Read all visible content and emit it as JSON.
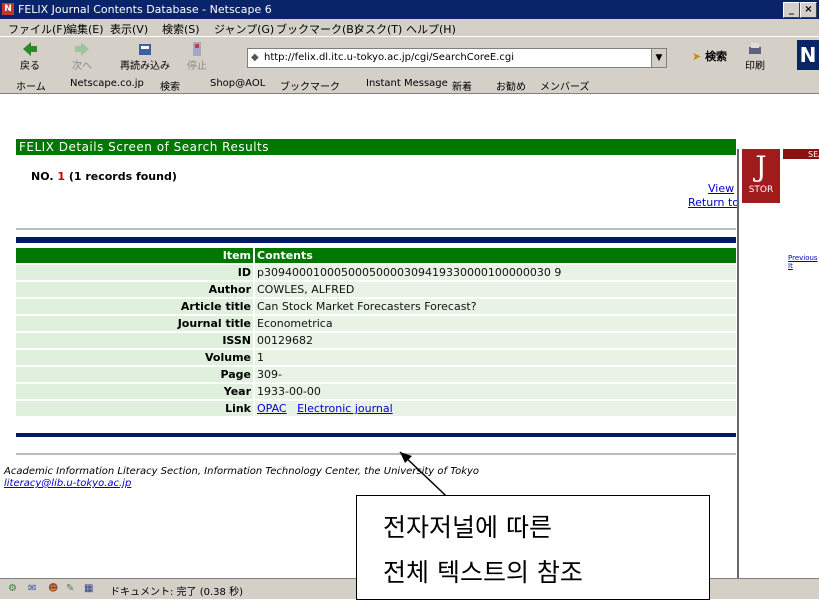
{
  "window": {
    "title": "FELIX  Journal Contents Database - Netscape 6",
    "controls": [
      "_",
      "×"
    ]
  },
  "menu": [
    "ファイル(F)",
    "編集(E)",
    "表示(V)",
    "検索(S)",
    "ジャンプ(G)",
    "ブックマーク(B)",
    "タスク(T)",
    "ヘルプ(H)"
  ],
  "toolbar": {
    "back": "戻る",
    "forward": "次へ",
    "reload": "再読み込み",
    "stop": "停止",
    "url": "http://felix.dl.itc.u-tokyo.ac.jp/cgi/SearchCoreE.cgi",
    "search": "検索",
    "print": "印刷",
    "brand": "N"
  },
  "personal_toolbar": [
    "ホーム",
    "Netscape.co.jp",
    "検索",
    "Shop@AOL",
    "ブックマーク",
    "Instant Message",
    "新着",
    "お勧め",
    "メンバーズ"
  ],
  "page": {
    "header": "FELIX  Details Screen of Search Results",
    "records_prefix": "NO. ",
    "records_number": "1",
    "records_suffix": " (1 records found)",
    "view_link": "View",
    "return_link": "Return to",
    "table_header": {
      "item": "Item",
      "contents": "Contents"
    },
    "rows": [
      {
        "key": "ID",
        "value": "p30940001000500050000309419330000100000030 9"
      },
      {
        "key": "Author",
        "value": "COWLES, ALFRED"
      },
      {
        "key": "Article title",
        "value": "Can Stock Market Forecasters Forecast?"
      },
      {
        "key": "Journal title",
        "value": "Econometrica"
      },
      {
        "key": "ISSN",
        "value": "00129682"
      },
      {
        "key": "Volume",
        "value": "1"
      },
      {
        "key": "Page",
        "value": "309-"
      },
      {
        "key": "Year",
        "value": "1933-00-00"
      }
    ],
    "link_key": "Link",
    "link_opac": "OPAC",
    "link_ejournal": "Electronic journal",
    "footer": "Academic Information Literacy Section, Information Technology Center, the University of Tokyo",
    "footer_email": "literacy@lib.u-tokyo.ac.jp"
  },
  "right_frame": {
    "logo_letter": "J",
    "logo_text": "STOR",
    "top_text": "SEA",
    "previous": "Previous It"
  },
  "status": {
    "text": "ドキュメント: 完了 (0.38 秒)"
  },
  "annotation": {
    "line1": "전자저널에 따른",
    "line2": "전체 텍스트의 참조"
  },
  "colors": {
    "header_green": "#007700",
    "navy": "#001a66",
    "link_blue": "#0000cc"
  }
}
